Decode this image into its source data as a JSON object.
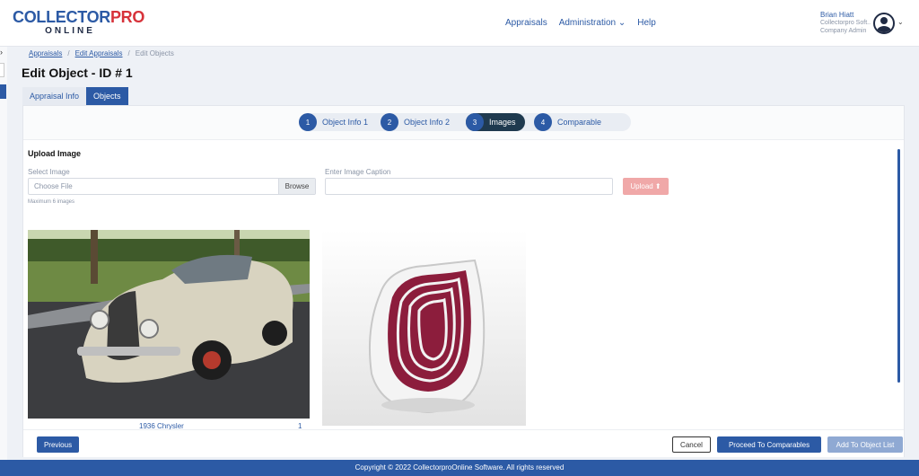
{
  "brand": {
    "logo_part1": "COLLECTOR",
    "logo_part2": "PRO",
    "logo_sub": "ONLINE"
  },
  "nav": {
    "appraisals": "Appraisals",
    "administration": "Administration",
    "administration_caret": "⌄",
    "help": "Help"
  },
  "user": {
    "name": "Brian Hiatt",
    "company": "Collectorpro Soft..",
    "role": "Company Admin",
    "caret": "⌄"
  },
  "breadcrumb": {
    "item1": "Appraisals",
    "sep": "/",
    "item2": "Edit Appraisals",
    "item3": "Edit Objects"
  },
  "page_title": "Edit Object - ID # 1",
  "tabs": [
    {
      "label": "Appraisal Info",
      "active": false
    },
    {
      "label": "Objects",
      "active": true
    }
  ],
  "steps": [
    {
      "num": "1",
      "label": "Object Info 1",
      "active": false
    },
    {
      "num": "2",
      "label": "Object Info 2",
      "active": false
    },
    {
      "num": "3",
      "label": "Images",
      "active": true
    },
    {
      "num": "4",
      "label": "Comparable",
      "active": false
    }
  ],
  "upload": {
    "section_title": "Upload Image",
    "select_label": "Select Image",
    "file_placeholder": "Choose File",
    "browse_label": "Browse",
    "caption_label": "Enter Image Caption",
    "caption_value": "",
    "upload_label": "Upload ⬆",
    "hint": "Maximum 6 images"
  },
  "gallery": {
    "image1": {
      "caption": "1936 Chrysler",
      "number": "1"
    }
  },
  "actions": {
    "previous": "Previous",
    "cancel": "Cancel",
    "proceed": "Proceed To Comparables",
    "add": "Add To Object List"
  },
  "footer": "Copyright © 2022 CollectorproOnline Software. All rights reserved",
  "colors": {
    "primary": "#2c5aa5",
    "brand_red": "#d7323a",
    "upload_disabled": "#f0a8a8",
    "active_step": "#1f3a4f"
  },
  "icons": {
    "rail_arrow": "›",
    "upload": "upload-icon",
    "avatar": "user-avatar-icon"
  }
}
